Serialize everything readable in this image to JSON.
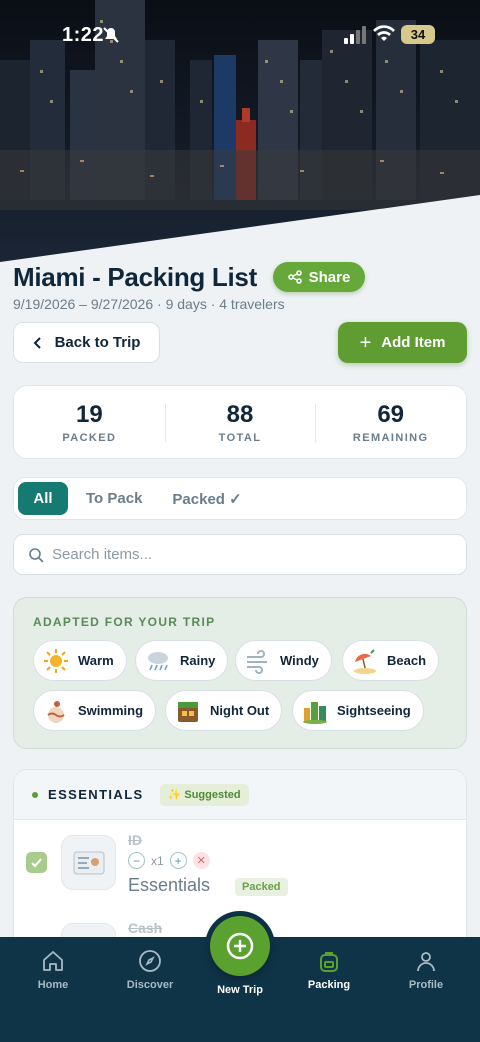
{
  "status_bar": {
    "time": "1:22",
    "battery": "34"
  },
  "header": {
    "title": "Miami - Packing List",
    "share_label": "Share",
    "subtitle": "9/19/2026 – 9/27/2026 · 9 days · 4 travelers"
  },
  "actions": {
    "back_label": "Back to Trip",
    "add_label": "Add Item"
  },
  "stats": [
    {
      "value": "19",
      "label": "PACKED"
    },
    {
      "value": "88",
      "label": "TOTAL"
    },
    {
      "value": "69",
      "label": "REMAINING"
    }
  ],
  "filters": {
    "tabs": [
      "All",
      "To Pack",
      "Packed ✓"
    ],
    "active": "All"
  },
  "search": {
    "placeholder": "Search items..."
  },
  "adapted": {
    "title": "ADAPTED FOR YOUR TRIP",
    "chips": [
      "Warm",
      "Rainy",
      "Windy",
      "Beach",
      "Swimming",
      "Night Out",
      "Sightseeing"
    ]
  },
  "essentials": {
    "title": "ESSENTIALS",
    "badge": "✨ Suggested",
    "items": [
      {
        "name": "ID",
        "qty": "x1",
        "category": "Essentials",
        "status": "Packed",
        "checked": true
      },
      {
        "name": "Cash"
      }
    ]
  },
  "nav": {
    "items": [
      "Home",
      "Discover",
      "New Trip",
      "Packing",
      "Profile"
    ],
    "active": "Packing"
  },
  "colors": {
    "primary_green": "#5f9d33",
    "teal": "#147a72",
    "navy": "#0f3447"
  }
}
